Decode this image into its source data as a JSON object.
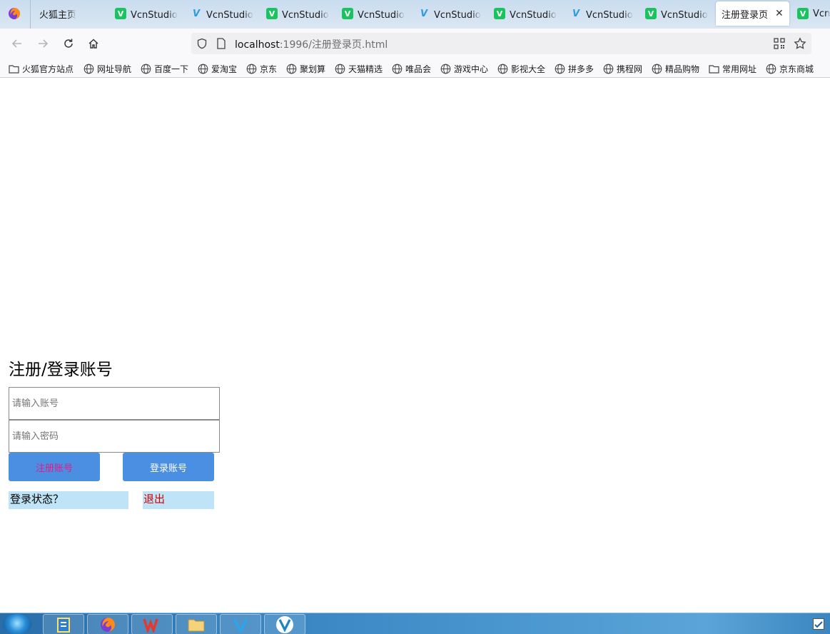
{
  "browser": {
    "tabs": [
      {
        "label": "火狐主页",
        "icon": "firefox-icon"
      },
      {
        "label": "VcnStudio开",
        "icon": "vcnstudio-icon"
      },
      {
        "label": "VcnStudio中",
        "icon": "vcnstudio-v-icon"
      },
      {
        "label": "VcnStudio开",
        "icon": "vcnstudio-icon"
      },
      {
        "label": "VcnStudio开",
        "icon": "vcnstudio-icon"
      },
      {
        "label": "VcnStudio中",
        "icon": "vcnstudio-v-icon"
      },
      {
        "label": "VcnStudio开",
        "icon": "vcnstudio-icon"
      },
      {
        "label": "VcnStudio中",
        "icon": "vcnstudio-v-icon"
      },
      {
        "label": "VcnStudio开",
        "icon": "vcnstudio-icon"
      },
      {
        "label": "注册登录页",
        "icon": "",
        "active": true
      },
      {
        "label": "VcnS",
        "icon": "vcnstudio-icon"
      }
    ],
    "url_host": "localhost",
    "url_path": ":1996/注册登录页.html",
    "bookmarks": [
      {
        "label": "火狐官方站点",
        "icon": "folder-icon"
      },
      {
        "label": "网址导航",
        "icon": "globe-icon"
      },
      {
        "label": "百度一下",
        "icon": "globe-icon"
      },
      {
        "label": "爱淘宝",
        "icon": "globe-icon"
      },
      {
        "label": "京东",
        "icon": "globe-icon"
      },
      {
        "label": "聚划算",
        "icon": "globe-icon"
      },
      {
        "label": "天猫精选",
        "icon": "globe-icon"
      },
      {
        "label": "唯品会",
        "icon": "globe-icon"
      },
      {
        "label": "游戏中心",
        "icon": "globe-icon"
      },
      {
        "label": "影视大全",
        "icon": "globe-icon"
      },
      {
        "label": "拼多多",
        "icon": "globe-icon"
      },
      {
        "label": "携程网",
        "icon": "globe-icon"
      },
      {
        "label": "精品购物",
        "icon": "globe-icon"
      },
      {
        "label": "常用网址",
        "icon": "folder-icon"
      },
      {
        "label": "京东商城",
        "icon": "globe-icon"
      }
    ]
  },
  "page": {
    "title": "注册/登录账号",
    "account_placeholder": "请输入账号",
    "password_placeholder": "请输入密码",
    "register_label": "注册账号",
    "login_label": "登录账号",
    "status_label": "登录状态？",
    "logout_label": "退出"
  },
  "colors": {
    "button_bg": "#4a8fe1",
    "register_text": "#e6198a",
    "login_text": "#ffffff",
    "status_bg": "#bfe3f7",
    "logout_text": "#d60000"
  }
}
